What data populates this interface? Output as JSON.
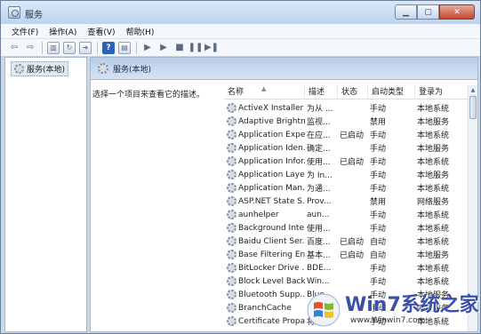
{
  "window": {
    "title": "服务"
  },
  "menu": [
    "文件(F)",
    "操作(A)",
    "查看(V)",
    "帮助(H)"
  ],
  "tree": {
    "root_label": "服务(本地)"
  },
  "main": {
    "header": "服务(本地)",
    "description_prompt": "选择一个项目来查看它的描述。"
  },
  "columns": [
    "名称",
    "描述",
    "状态",
    "启动类型",
    "登录为"
  ],
  "services": [
    {
      "name": "ActiveX Installer ...",
      "desc": "为从 ...",
      "status": "",
      "start": "手动",
      "logon": "本地系统"
    },
    {
      "name": "Adaptive Brightn...",
      "desc": "监视...",
      "status": "",
      "start": "禁用",
      "logon": "本地服务"
    },
    {
      "name": "Application Expe...",
      "desc": "在应...",
      "status": "已启动",
      "start": "手动",
      "logon": "本地系统"
    },
    {
      "name": "Application Iden...",
      "desc": "确定...",
      "status": "",
      "start": "手动",
      "logon": "本地服务"
    },
    {
      "name": "Application Infor...",
      "desc": "使用...",
      "status": "已启动",
      "start": "手动",
      "logon": "本地系统"
    },
    {
      "name": "Application Laye...",
      "desc": "为 In...",
      "status": "",
      "start": "手动",
      "logon": "本地服务"
    },
    {
      "name": "Application Man...",
      "desc": "为通...",
      "status": "",
      "start": "手动",
      "logon": "本地系统"
    },
    {
      "name": "ASP.NET State S...",
      "desc": "Prov...",
      "status": "",
      "start": "禁用",
      "logon": "网络服务"
    },
    {
      "name": "aunhelper",
      "desc": "aun...",
      "status": "",
      "start": "手动",
      "logon": "本地系统"
    },
    {
      "name": "Background Inte...",
      "desc": "使用...",
      "status": "",
      "start": "手动",
      "logon": "本地系统"
    },
    {
      "name": "Baidu Client Ser...",
      "desc": "百度...",
      "status": "已启动",
      "start": "自动",
      "logon": "本地系统"
    },
    {
      "name": "Base Filtering En...",
      "desc": "基本...",
      "status": "已启动",
      "start": "自动",
      "logon": "本地服务"
    },
    {
      "name": "BitLocker Drive ...",
      "desc": "BDE...",
      "status": "",
      "start": "手动",
      "logon": "本地系统"
    },
    {
      "name": "Block Level Back...",
      "desc": "Win...",
      "status": "",
      "start": "手动",
      "logon": "本地系统"
    },
    {
      "name": "Bluetooth Supp...",
      "desc": "Blue...",
      "status": "",
      "start": "手动",
      "logon": "本地服务"
    },
    {
      "name": "BranchCache",
      "desc": "此服...",
      "status": "",
      "start": "手动",
      "logon": "网络服务"
    },
    {
      "name": "Certificate Propa...",
      "desc": "将用...",
      "status": "",
      "start": "手动",
      "logon": "本地系统"
    }
  ],
  "watermark": {
    "title": "Win7系统之家",
    "url": "www.Winwin7.com"
  },
  "colors": {
    "accent": "#3a4fa8",
    "title_bar": "#c9daee",
    "close_button": "#c5452f"
  }
}
